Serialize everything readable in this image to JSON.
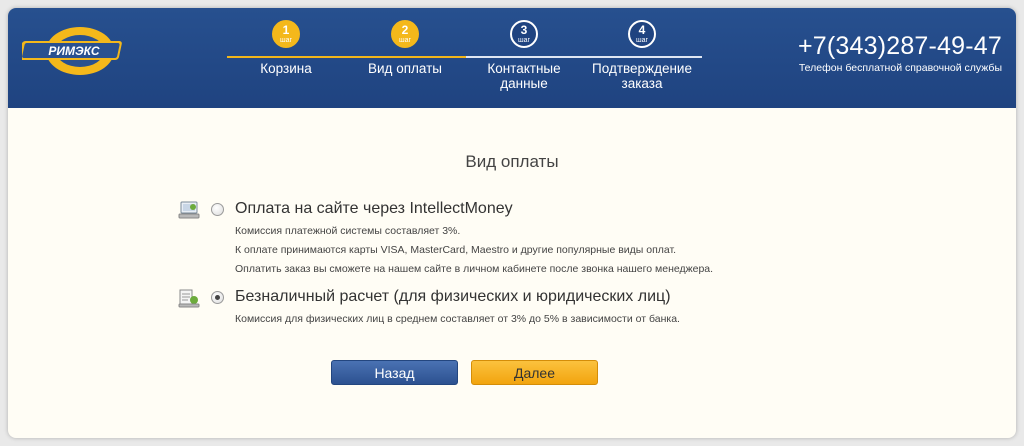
{
  "header": {
    "logo_text": "РИМЭКС",
    "phone": "+7(343)287-49-47",
    "phone_caption": "Телефон бесплатной справочной службы"
  },
  "steps": [
    {
      "num": "1",
      "word": "шаг",
      "label": "Корзина",
      "status": "done"
    },
    {
      "num": "2",
      "word": "шаг",
      "label": "Вид оплаты",
      "status": "current"
    },
    {
      "num": "3",
      "word": "шаг",
      "label": "Контактные данные",
      "status": "todo"
    },
    {
      "num": "4",
      "word": "шаг",
      "label": "Подтверждение заказа",
      "status": "todo"
    }
  ],
  "main": {
    "title": "Вид оплаты",
    "options": [
      {
        "title": "Оплата на сайте через IntellectMoney",
        "checked": false,
        "icon": "online-payment-icon",
        "lines": [
          "Комиссия платежной системы составляет 3%.",
          "К оплате принимаются карты VISA, MasterCard, Maestro и другие популярные виды оплат.",
          "Оплатить заказ вы сможете на нашем сайте в личном кабинете после звонка нашего менеджера."
        ]
      },
      {
        "title": "Безналичный расчет (для физических и юридических лиц)",
        "checked": true,
        "icon": "bank-transfer-icon",
        "lines": [
          "Комиссия  для физических лиц в среднем составляет от 3% до 5% в зависимости от банка."
        ]
      }
    ]
  },
  "buttons": {
    "back": "Назад",
    "next": "Далее"
  },
  "colors": {
    "header_bg": "#2a5190",
    "accent_yellow": "#f4b81b",
    "page_bg": "#fffdf5"
  }
}
